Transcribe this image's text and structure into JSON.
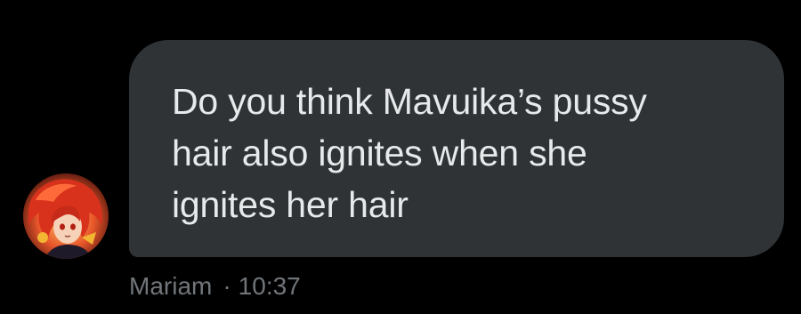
{
  "message": {
    "text": "Do you think Mavuika’s pussy\nhair also ignites when she\nignites her hair",
    "sender": "Mariam",
    "separator": "·",
    "time": "10:37"
  },
  "avatar": {
    "icon": "anime-avatar-image"
  },
  "colors": {
    "background": "#000000",
    "bubble": "#2f3336",
    "text": "#e7e9ea",
    "meta": "#71767b"
  }
}
